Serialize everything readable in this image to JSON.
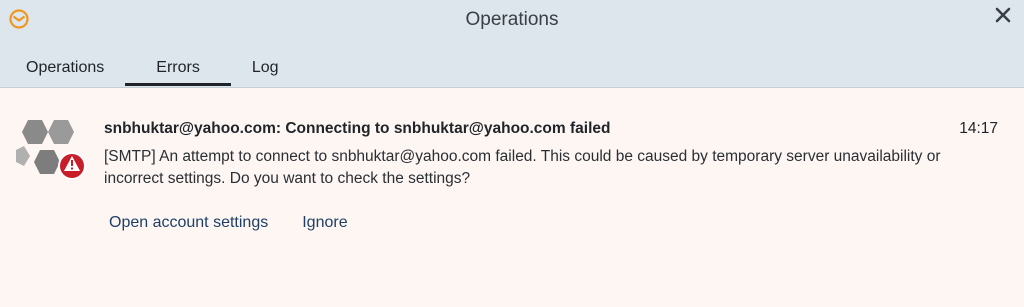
{
  "window": {
    "title": "Operations",
    "app_icon": "em-client-logo-icon",
    "close_icon": "close-icon"
  },
  "tabs": [
    {
      "label": "Operations",
      "active": false
    },
    {
      "label": "Errors",
      "active": true
    },
    {
      "label": "Log",
      "active": false
    }
  ],
  "error": {
    "icon": "gear-error-icon",
    "title": "snbhuktar@yahoo.com: Connecting to snbhuktar@yahoo.com failed",
    "time": "14:17",
    "message_line1": "[SMTP] An attempt to connect to snbhuktar@yahoo.com failed. This could be caused by temporary server unavailability or",
    "message_line2": "incorrect settings. Do you want to check the settings?",
    "actions": {
      "open_settings": "Open account settings",
      "ignore": "Ignore"
    }
  },
  "colors": {
    "titlebar_bg": "#dce6ec",
    "content_bg": "#fdf6f3",
    "link": "#1e3f66",
    "error_red": "#c81e2a",
    "accent_orange": "#f0961e"
  }
}
